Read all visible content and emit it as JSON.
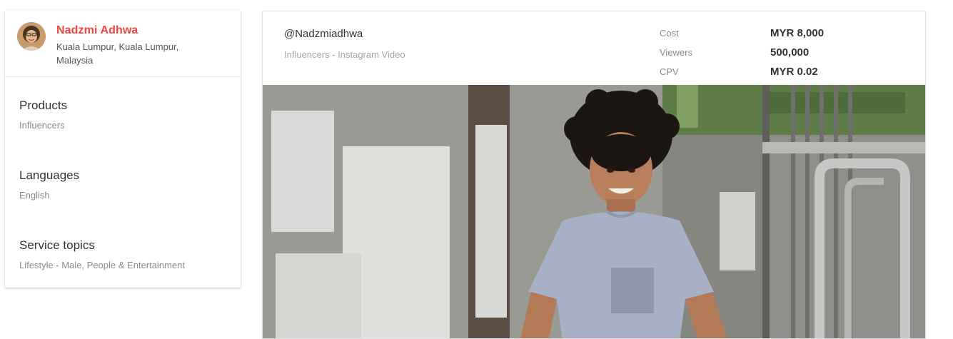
{
  "profile": {
    "name": "Nadzmi Adhwa",
    "location": "Kuala Lumpur, Kuala Lumpur, Malaysia",
    "avatar_icon": "avatar-photo"
  },
  "sections": {
    "products": {
      "title": "Products",
      "value": "Influencers"
    },
    "languages": {
      "title": "Languages",
      "value": "English"
    },
    "service_topics": {
      "title": "Service topics",
      "value": "Lifestyle - Male, People & Entertainment"
    }
  },
  "listing": {
    "handle": "@Nadzmiadhwa",
    "subtitle": "Influencers - Instagram Video",
    "stats": [
      {
        "label": "Cost",
        "value": "MYR 8,000"
      },
      {
        "label": "Viewers",
        "value": "500,000"
      },
      {
        "label": "CPV",
        "value": "MYR 0.02"
      }
    ],
    "photo_icon": "influencer-photo"
  },
  "colors": {
    "accent": "#f1453d",
    "text_primary": "#333333",
    "text_muted": "#8a8a8a"
  }
}
